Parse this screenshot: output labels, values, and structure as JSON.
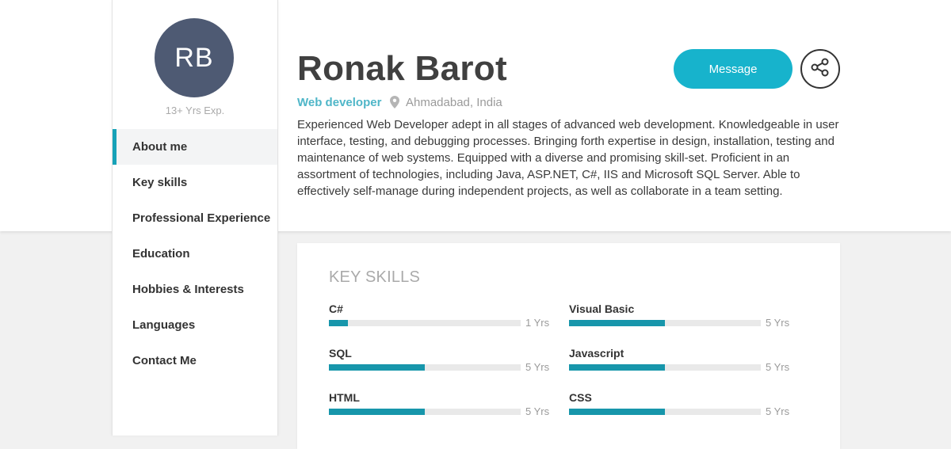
{
  "profile": {
    "initials": "RB",
    "experience": "13+ Yrs Exp.",
    "name": "Ronak Barot",
    "role": "Web developer",
    "location": "Ahmadabad, India",
    "bio": "Experienced Web Developer adept in all stages of advanced web development. Knowledgeable in user interface, testing, and debugging processes. Bringing forth expertise in design, installation, testing and maintenance of web systems. Equipped with a diverse and promising skill-set. Proficient in an assortment of technologies, including Java, ASP.NET, C#, IIS and Microsoft SQL Server. Able to effectively self-manage during independent projects, as well as collaborate in a team setting."
  },
  "actions": {
    "message_label": "Message",
    "share_icon": "share-icon"
  },
  "nav": {
    "items": [
      {
        "label": "About me",
        "active": true
      },
      {
        "label": "Key skills",
        "active": false
      },
      {
        "label": "Professional Experience",
        "active": false
      },
      {
        "label": "Education",
        "active": false
      },
      {
        "label": "Hobbies & Interests",
        "active": false
      },
      {
        "label": "Languages",
        "active": false
      },
      {
        "label": "Contact Me",
        "active": false
      }
    ]
  },
  "skills": {
    "title": "KEY SKILLS",
    "items": [
      {
        "name": "C#",
        "years": "1 Yrs",
        "level": 0.1
      },
      {
        "name": "Visual Basic",
        "years": "5 Yrs",
        "level": 0.5
      },
      {
        "name": "SQL",
        "years": "5 Yrs",
        "level": 0.5
      },
      {
        "name": "Javascript",
        "years": "5 Yrs",
        "level": 0.5
      },
      {
        "name": "HTML",
        "years": "5 Yrs",
        "level": 0.5
      },
      {
        "name": "CSS",
        "years": "5 Yrs",
        "level": 0.5
      }
    ]
  },
  "colors": {
    "accent": "#17b3cc",
    "bar": "#1796ab",
    "avatar": "#4e5a73"
  }
}
